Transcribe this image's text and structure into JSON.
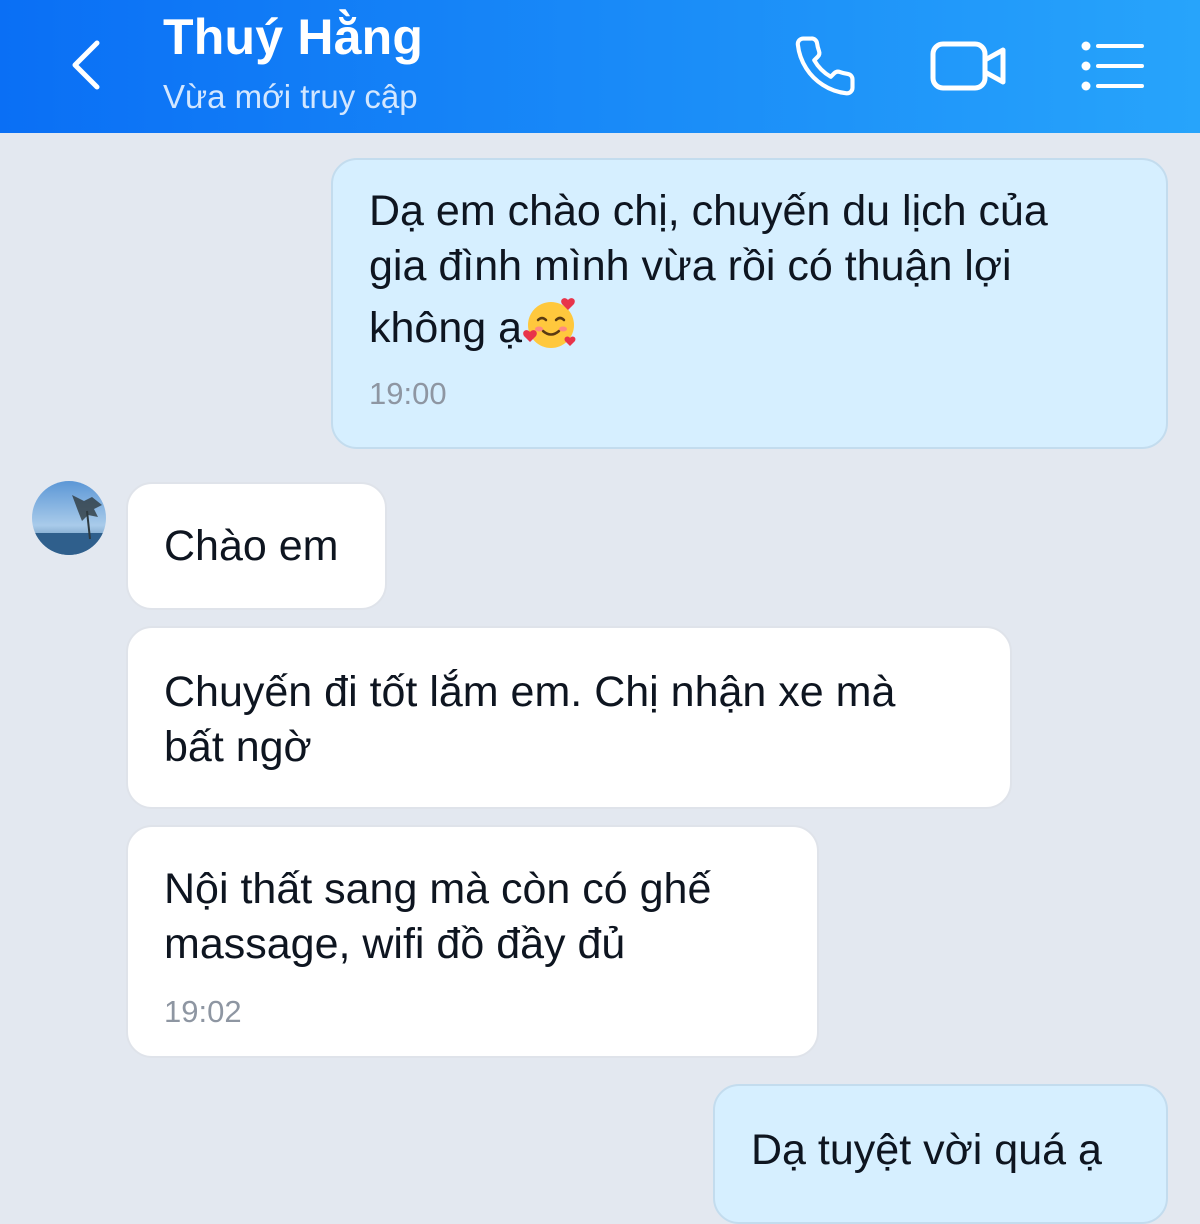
{
  "header": {
    "contact_name": "Thuý Hằng",
    "status": "Vừa mới truy cập",
    "icons": {
      "back": "chevron-left-icon",
      "call": "phone-icon",
      "video": "video-camera-icon",
      "menu": "list-menu-icon"
    }
  },
  "messages": [
    {
      "direction": "sent",
      "text": "Dạ em chào chị, chuyến du lịch của\ngia đình mình vừa rồi có thuận lợi\nkhông ạ",
      "emoji": "smiling-face-with-hearts",
      "time": "19:00"
    },
    {
      "direction": "received",
      "text": "Chào em"
    },
    {
      "direction": "received",
      "text": "Chuyến đi tốt lắm em. Chị nhận xe mà\nbất ngờ"
    },
    {
      "direction": "received",
      "text": "Nội thất sang mà còn có ghế\nmassage, wifi đồ đầy đủ",
      "time": "19:02"
    },
    {
      "direction": "sent",
      "text": "Dạ tuyệt vời quá ạ"
    }
  ],
  "colors": {
    "header_start": "#0a6ff5",
    "header_end": "#27a4fb",
    "background": "#e3e8f0",
    "sent_bubble": "#d6efff",
    "received_bubble": "#ffffff"
  }
}
